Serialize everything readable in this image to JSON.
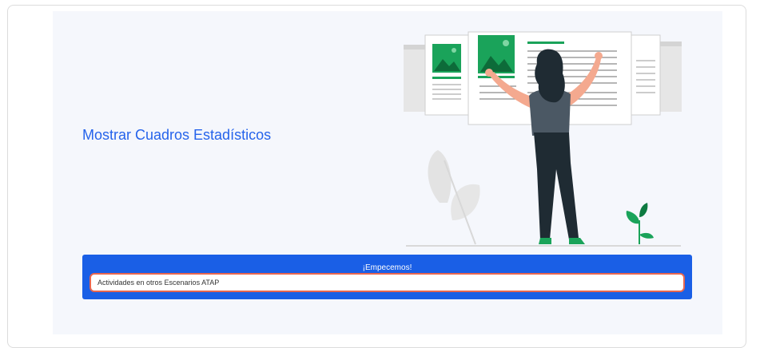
{
  "page": {
    "title": "Mostrar Cuadros Estadísticos"
  },
  "start": {
    "label": "¡Empecemos!",
    "select_value": "Actividades en otros Escenarios ATAP"
  },
  "colors": {
    "accent": "#1a5fe6",
    "title": "#2563eb",
    "field_border": "#e8664f",
    "panel_bg": "#f5f7fc",
    "illustration_green": "#1aa35a"
  },
  "icons": {
    "illustration": "woman-arranging-documents-illustration"
  }
}
